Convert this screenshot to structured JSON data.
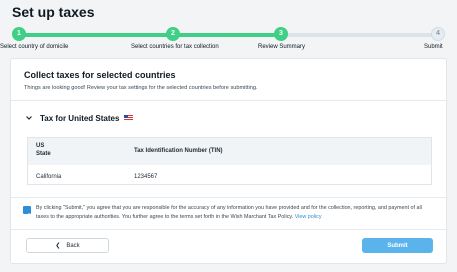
{
  "title": "Set up taxes",
  "stepper": {
    "steps": [
      {
        "number": "1",
        "label": "Select country of domicile",
        "state": "done"
      },
      {
        "number": "2",
        "label": "Select countries for tax collection",
        "state": "done"
      },
      {
        "number": "3",
        "label": "Review Summary",
        "state": "done"
      },
      {
        "number": "4",
        "label": "Submit",
        "state": "todo"
      }
    ],
    "done_color": "#3fcf86"
  },
  "card": {
    "title": "Collect taxes for selected countries",
    "subtitle": "Things are looking good! Review your tax settings for the selected countries before submitting.",
    "country_section": {
      "title": "Tax for United States",
      "flag_icon": "us-flag-icon",
      "table": {
        "col1_header_line1": "US",
        "col1_header_line2": "State",
        "col2_header": "Tax Identification Number (TIN)",
        "rows": [
          {
            "state": "California",
            "tin": "1234567"
          }
        ]
      }
    },
    "agreement": {
      "checked": true,
      "text": "By clicking \"Submit,\" you agree that you are responsible for the accuracy of any information you have provided and for the collection, reporting, and payment of all taxes to the appropriate authorities. You further agree to the terms set forth in the Wish Marchant Tax Policy.",
      "link": "View policy"
    },
    "back_label": "Back",
    "submit_label": "Submit",
    "accent_color": "#2f8ed8"
  }
}
